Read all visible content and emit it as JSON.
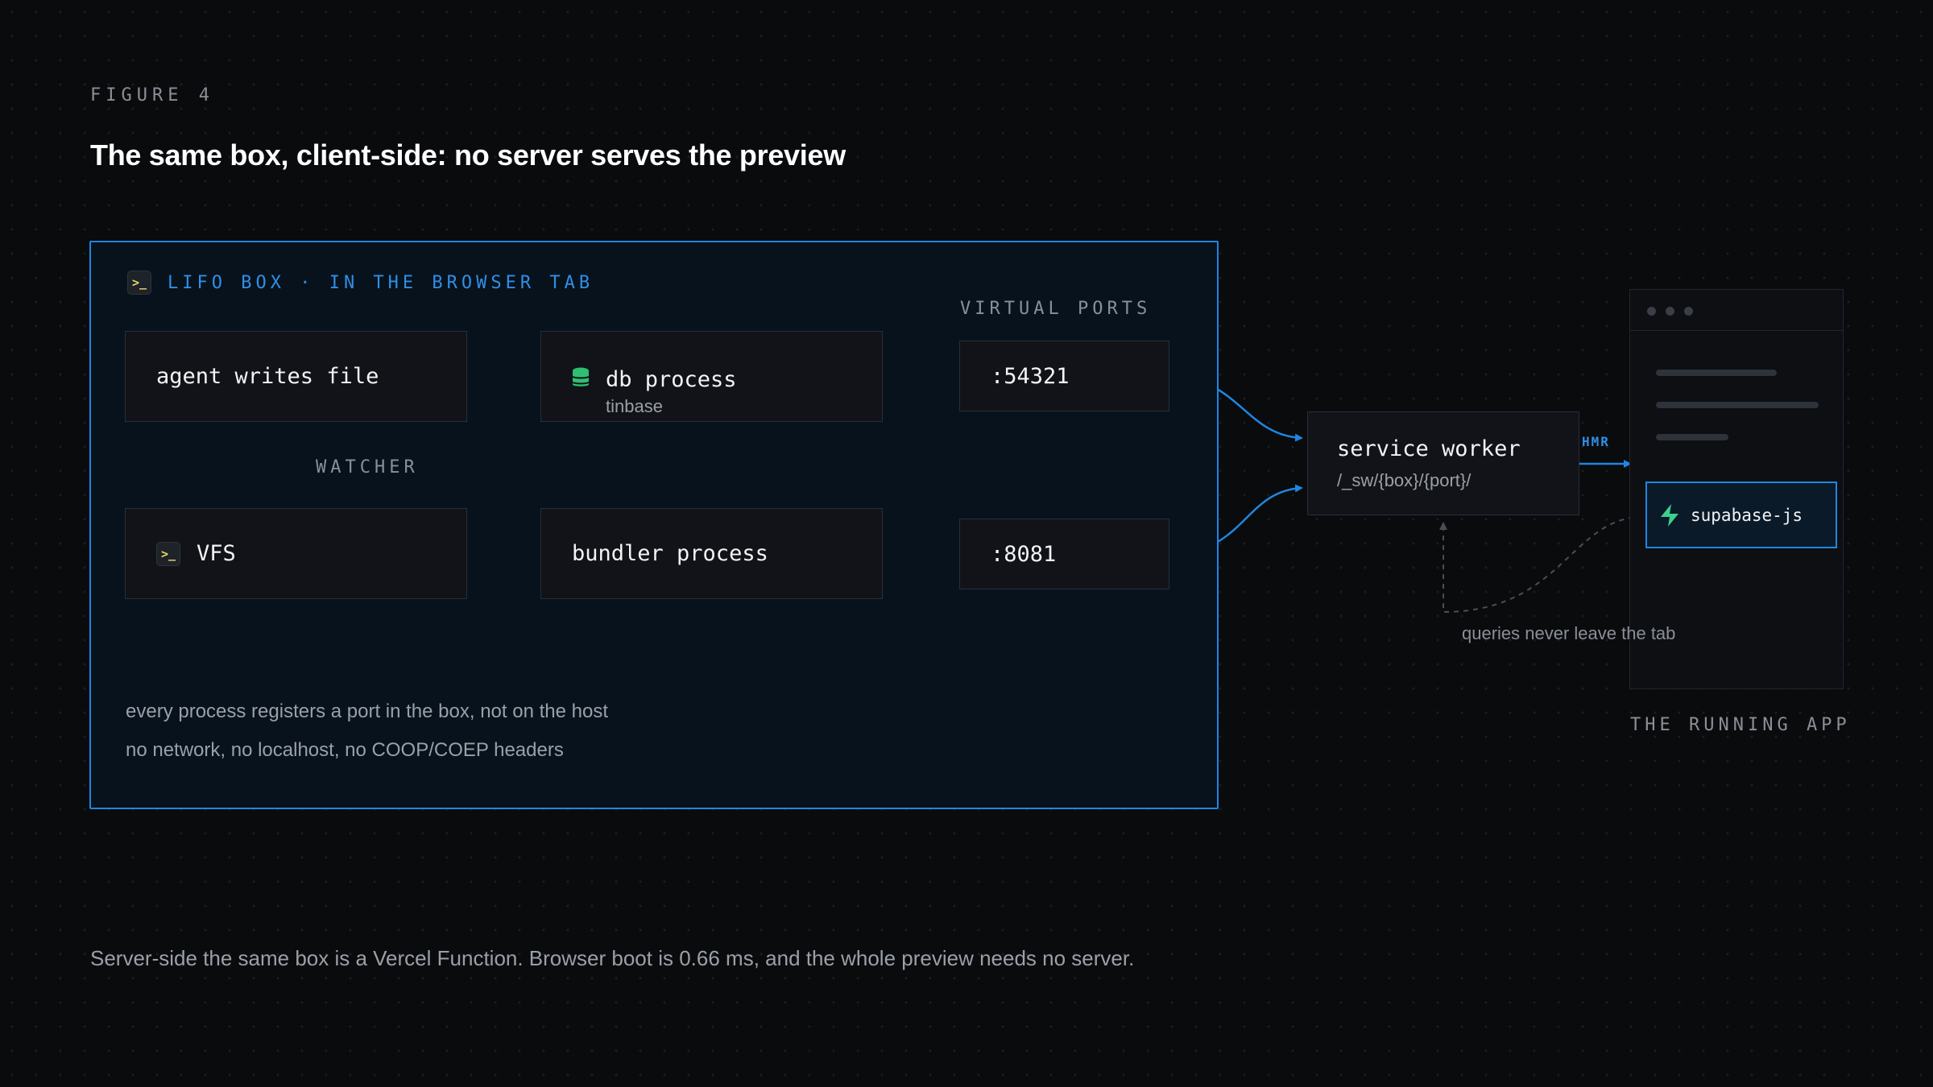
{
  "figure": {
    "eyebrow": "FIGURE 4",
    "title": "The same box, client-side: no server serves the preview"
  },
  "box": {
    "label": "LIFO BOX · IN THE BROWSER TAB",
    "ports_label": "VIRTUAL PORTS",
    "notes": [
      "every process registers a port in the box, not on the host",
      "no network, no localhost, no COOP/COEP headers"
    ]
  },
  "nodes": {
    "agent": {
      "label": "agent writes file"
    },
    "watcher": "WATCHER",
    "vfs": {
      "label": "VFS",
      "icon": "terminal-icon"
    },
    "db": {
      "label": "db process",
      "sub": "tinbase",
      "icon": "database-icon"
    },
    "bundler": {
      "label": "bundler process"
    },
    "port_db": ":54321",
    "port_bundler": ":8081",
    "service_worker": {
      "label": "service worker",
      "sub": "/_sw/{box}/{port}/"
    }
  },
  "app": {
    "hmr": "HMR",
    "supabase": {
      "label": "supabase-js",
      "icon": "supabase-bolt-icon"
    },
    "caption": "THE RUNNING APP",
    "queries_note": "queries never leave the tab"
  },
  "footer": "Server-side the same box is a Vercel Function. Browser boot is 0.66 ms, and the whole preview needs no server.",
  "colors": {
    "background": "#0a0b0d",
    "accent": "#1f86e0",
    "node_bg": "#111318",
    "db_icon": "#2fbf71",
    "supabase_icon": "#3ecf8e"
  }
}
